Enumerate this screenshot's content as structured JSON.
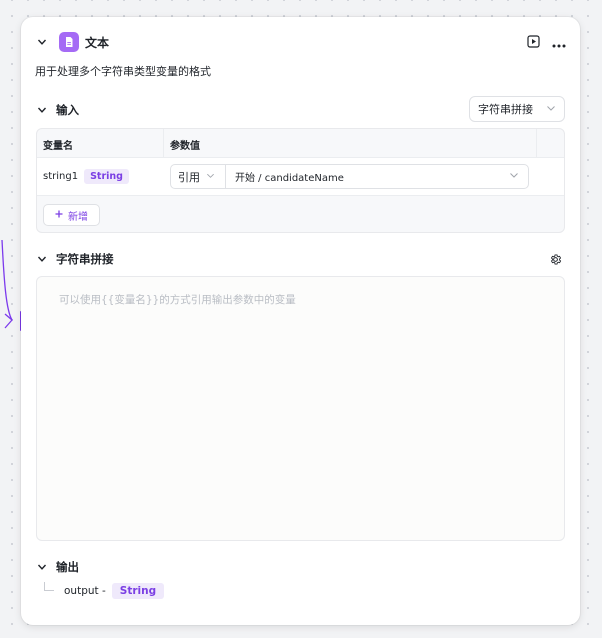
{
  "node": {
    "title": "文本",
    "description": "用于处理多个字符串类型变量的格式",
    "icons": {
      "collapse": "chevron-down-icon",
      "node": "document-icon",
      "run": "play-icon",
      "more": "more-icon"
    },
    "accent_color": "#7b3fe4"
  },
  "input": {
    "title": "输入",
    "mode_select": {
      "value": "字符串拼接"
    },
    "table": {
      "headers": [
        "变量名",
        "参数值"
      ],
      "rows": [
        {
          "name": "string1",
          "type": "String",
          "source": "引用",
          "value": "开始 / candidateName"
        }
      ]
    },
    "add_button": "新增"
  },
  "concat": {
    "title": "字符串拼接",
    "placeholder": "可以使用{{变量名}}的方式引用输出参数中的变量"
  },
  "output": {
    "title": "输出",
    "items": [
      {
        "name": "output -",
        "type": "String"
      }
    ]
  }
}
